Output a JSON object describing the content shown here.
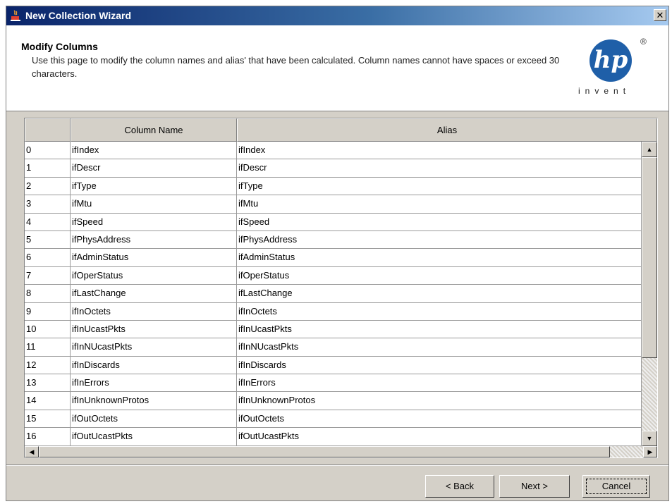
{
  "window": {
    "title": "New Collection Wizard",
    "close_label": "✕"
  },
  "header": {
    "heading": "Modify Columns",
    "description": "Use this page to modify the column names and alias' that have been calculated. Column names cannot have spaces or exceed 30 characters.",
    "logo_text": "hp",
    "logo_registered": "®",
    "logo_tagline": "invent"
  },
  "table": {
    "columns": [
      "",
      "Column Name",
      "Alias"
    ],
    "rows": [
      [
        "0",
        "ifIndex",
        "ifIndex"
      ],
      [
        "1",
        "ifDescr",
        "ifDescr"
      ],
      [
        "2",
        "ifType",
        "ifType"
      ],
      [
        "3",
        "ifMtu",
        "ifMtu"
      ],
      [
        "4",
        "ifSpeed",
        "ifSpeed"
      ],
      [
        "5",
        "ifPhysAddress",
        "ifPhysAddress"
      ],
      [
        "6",
        "ifAdminStatus",
        "ifAdminStatus"
      ],
      [
        "7",
        "ifOperStatus",
        "ifOperStatus"
      ],
      [
        "8",
        "ifLastChange",
        "ifLastChange"
      ],
      [
        "9",
        "ifInOctets",
        "ifInOctets"
      ],
      [
        "10",
        "ifInUcastPkts",
        "ifInUcastPkts"
      ],
      [
        "11",
        "ifInNUcastPkts",
        "ifInNUcastPkts"
      ],
      [
        "12",
        "ifInDiscards",
        "ifInDiscards"
      ],
      [
        "13",
        "ifInErrors",
        "ifInErrors"
      ],
      [
        "14",
        "ifInUnknownProtos",
        "ifInUnknownProtos"
      ],
      [
        "15",
        "ifOutOctets",
        "ifOutOctets"
      ],
      [
        "16",
        "ifOutUcastPkts",
        "ifOutUcastPkts"
      ]
    ]
  },
  "buttons": {
    "back": "< Back",
    "next": "Next >",
    "cancel": "Cancel"
  },
  "colors": {
    "titlebar_start": "#0a246a",
    "dialog_bg": "#d4d0c8",
    "hp_blue": "#1f5fa8"
  }
}
